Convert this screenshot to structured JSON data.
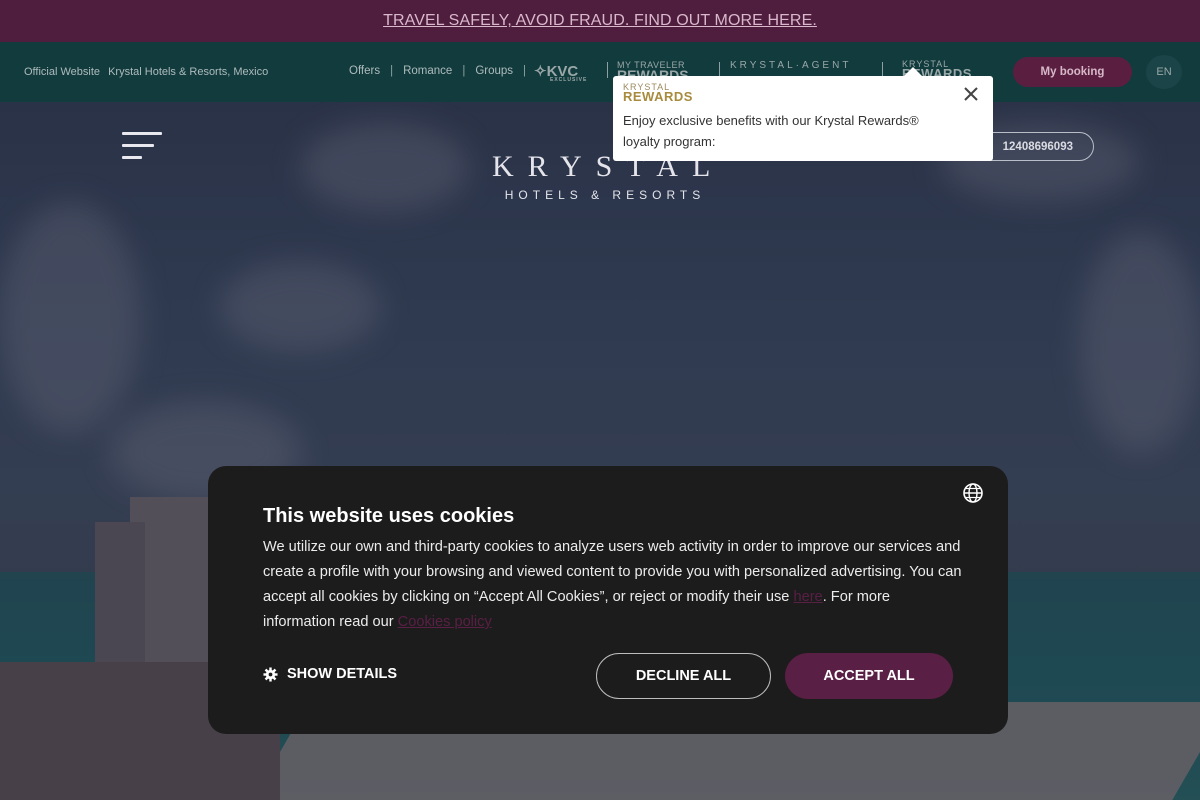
{
  "alert": {
    "text": "TRAVEL SAFELY, AVOID FRAUD. FIND OUT MORE HERE."
  },
  "subnav": {
    "official": "Official Website",
    "company": "Krystal Hotels & Resorts, Mexico",
    "links": [
      "Offers",
      "Romance",
      "Groups"
    ],
    "brands": {
      "kvc": "KVC",
      "kvc_sub": "EXCLUSIVE",
      "mtr_top": "MY TRAVELER",
      "mtr_bottom": "REWARDS",
      "agent": "KRYSTAL·AGENT",
      "krew_top": "KRYSTAL",
      "krew_bottom": "REWARDS"
    },
    "booking": "My booking",
    "lang": "EN"
  },
  "hero": {
    "logo_main": "KRYSTAL",
    "logo_sub": "HOTELS & RESORTS",
    "phone": "12408696093"
  },
  "tooltip": {
    "brand_top": "KRYSTAL",
    "brand_bottom": "REWARDS",
    "text": "Enjoy exclusive benefits with our Krystal Rewards® loyalty program:"
  },
  "cookie": {
    "title": "This website uses cookies",
    "text_1": "We utilize our own and third-party cookies to analyze users web activity in order to improve our services and create a profile with your browsing and viewed content to provide you with personalized advertising. You can accept all cookies by clicking on “Accept All Cookies”, or reject or modify their use ",
    "here": "here",
    "text_2": ". For more information read our ",
    "policy": "Cookies policy",
    "show_details": "SHOW DETAILS",
    "decline": "DECLINE ALL",
    "accept": "ACCEPT ALL"
  },
  "colors": {
    "primary": "#5a1f45",
    "alert_bg": "#4f1d3d",
    "nav_bg": "#123b3e",
    "dialog_bg": "#1c1c1c"
  }
}
